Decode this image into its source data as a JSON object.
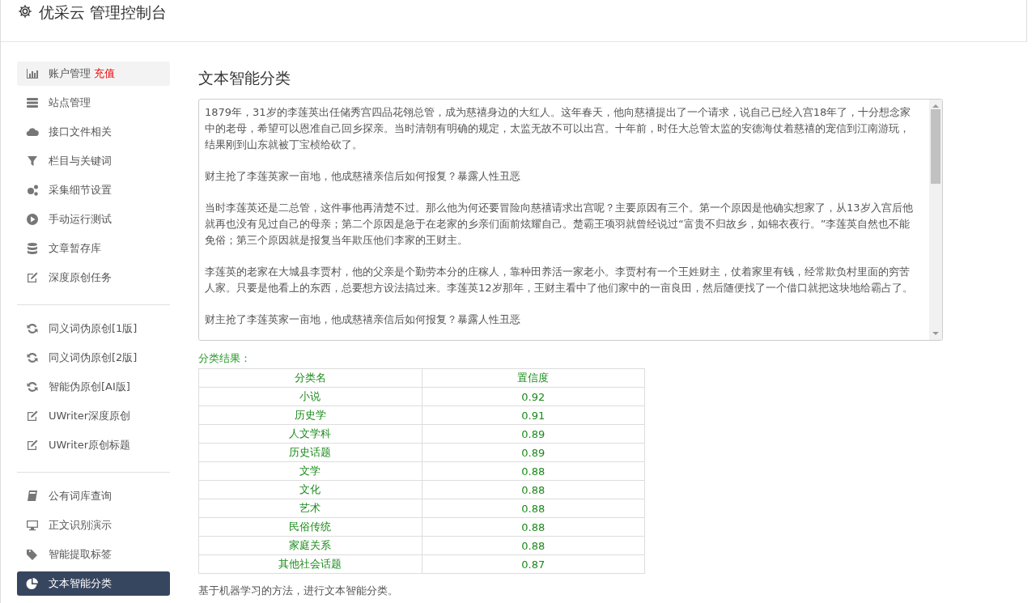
{
  "header": {
    "title": "优采云 管理控制台"
  },
  "sidebar": {
    "groups": [
      [
        {
          "label": "账户管理",
          "badge": "充值",
          "selected": false,
          "highlighted": true
        },
        {
          "label": "站点管理",
          "selected": false,
          "highlighted": false
        },
        {
          "label": "接口文件相关",
          "selected": false,
          "highlighted": false
        },
        {
          "label": "栏目与关键词",
          "selected": false,
          "highlighted": false
        },
        {
          "label": "采集细节设置",
          "selected": false,
          "highlighted": false
        },
        {
          "label": "手动运行测试",
          "selected": false,
          "highlighted": false
        },
        {
          "label": "文章暂存库",
          "selected": false,
          "highlighted": false
        },
        {
          "label": "深度原创任务",
          "selected": false,
          "highlighted": false
        }
      ],
      [
        {
          "label": "同义词伪原创[1版]",
          "selected": false,
          "highlighted": false
        },
        {
          "label": "同义词伪原创[2版]",
          "selected": false,
          "highlighted": false
        },
        {
          "label": "智能伪原创[AI版]",
          "selected": false,
          "highlighted": false
        },
        {
          "label": "UWriter深度原创",
          "selected": false,
          "highlighted": false
        },
        {
          "label": "UWriter原创标题",
          "selected": false,
          "highlighted": false
        }
      ],
      [
        {
          "label": "公有词库查询",
          "selected": false,
          "highlighted": false
        },
        {
          "label": "正文识别演示",
          "selected": false,
          "highlighted": false
        },
        {
          "label": "智能提取标签",
          "selected": false,
          "highlighted": false
        },
        {
          "label": "文本智能分类",
          "selected": true,
          "highlighted": false
        }
      ]
    ]
  },
  "main": {
    "title": "文本智能分类",
    "text_area": {
      "paragraphs": [
        "1879年，31岁的李莲英出任储秀宫四品花翎总管，成为慈禧身边的大红人。这年春天，他向慈禧提出了一个请求，说自己已经入宫18年了，十分想念家中的老母，希望可以恩准自己回乡探亲。当时清朝有明确的规定，太监无故不可以出宫。十年前，时任大总管太监的安德海仗着慈禧的宠信到江南游玩，结果刚到山东就被丁宝桢给砍了。",
        "财主抢了李莲英家一亩地，他成慈禧亲信后如何报复？暴露人性丑恶",
        "当时李莲英还是二总管，这件事他再清楚不过。那么他为何还要冒险向慈禧请求出宫呢？主要原因有三个。第一个原因是他确实想家了，从13岁入宫后他就再也没有见过自己的母亲；第二个原因是急于在老家的乡亲们面前炫耀自己。楚霸王项羽就曾经说过“富贵不归故乡，如锦衣夜行。”李莲英自然也不能免俗；第三个原因就是报复当年欺压他们李家的王财主。",
        "李莲英的老家在大城县李贾村，他的父亲是个勤劳本分的庄稼人，靠种田养活一家老小。李贾村有一个王姓财主，仗着家里有钱，经常欺负村里面的穷苦人家。只要是他看上的东西，总要想方设法搞过来。李莲英12岁那年，王财主看中了他们家中的一亩良田，然后随便找了一个借口就把这块地给霸占了。",
        "财主抢了李莲英家一亩地，他成慈禧亲信后如何报复？暴露人性丑恶"
      ]
    },
    "result_label": "分类结果：",
    "table": {
      "columns": [
        "分类名",
        "置信度"
      ],
      "rows": [
        [
          "小说",
          "0.92"
        ],
        [
          "历史学",
          "0.91"
        ],
        [
          "人文学科",
          "0.89"
        ],
        [
          "历史话题",
          "0.89"
        ],
        [
          "文学",
          "0.88"
        ],
        [
          "文化",
          "0.88"
        ],
        [
          "艺术",
          "0.88"
        ],
        [
          "民俗传统",
          "0.88"
        ],
        [
          "家庭关系",
          "0.88"
        ],
        [
          "其他社会话题",
          "0.87"
        ]
      ]
    },
    "footnote": "基于机器学习的方法，进行文本智能分类。"
  }
}
